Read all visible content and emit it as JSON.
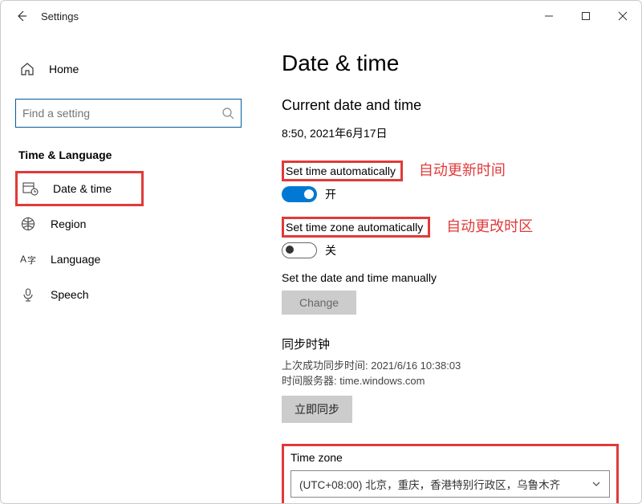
{
  "titlebar": {
    "title": "Settings"
  },
  "sidebar": {
    "home": "Home",
    "search_placeholder": "Find a setting",
    "section": "Time & Language",
    "items": [
      {
        "label": "Date & time"
      },
      {
        "label": "Region"
      },
      {
        "label": "Language"
      },
      {
        "label": "Speech"
      }
    ]
  },
  "content": {
    "heading": "Date & time",
    "subheading": "Current date and time",
    "datetime": "8:50, 2021年6月17日",
    "set_time_auto_label": "Set time automatically",
    "set_time_auto_annot": "自动更新时间",
    "toggle_on_text": "开",
    "set_tz_auto_label": "Set time zone automatically",
    "set_tz_auto_annot": "自动更改时区",
    "toggle_off_text": "关",
    "manual_label": "Set the date and time manually",
    "change_btn": "Change",
    "sync": {
      "heading": "同步时钟",
      "last": "上次成功同步时间: 2021/6/16 10:38:03",
      "server": "时间服务器: time.windows.com",
      "btn": "立即同步"
    },
    "timezone": {
      "label": "Time zone",
      "value": "(UTC+08:00) 北京，重庆，香港特别行政区，乌鲁木齐"
    }
  }
}
